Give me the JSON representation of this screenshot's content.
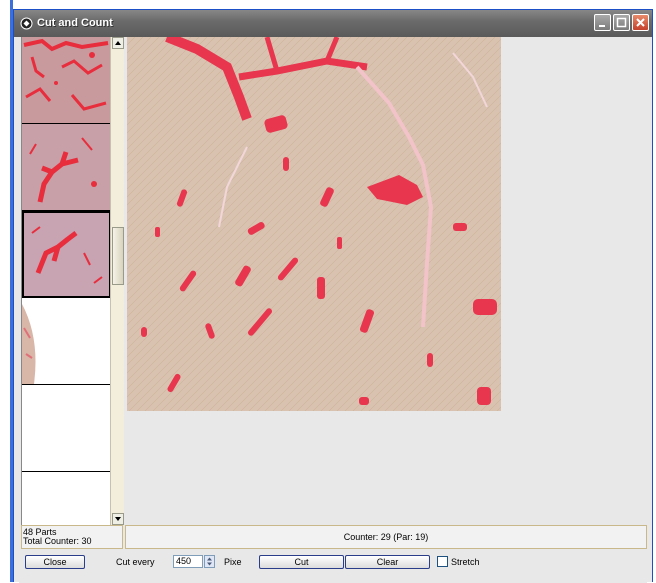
{
  "window": {
    "title": "Cut and Count"
  },
  "status": {
    "parts": "48 Parts",
    "total_counter": "Total Counter: 30",
    "counter": "Counter: 29  (Par: 19)"
  },
  "toolbar": {
    "close_label": "Close",
    "cut_every_label": "Cut every",
    "cut_every_value": "450",
    "unit_label": "Pixe",
    "cut_label": "Cut",
    "clear_label": "Clear",
    "stretch_label": "Stretch",
    "stretch_checked": false
  },
  "thumbnails": {
    "count_visible": 6,
    "selected_index": 2
  },
  "colors": {
    "tissue": "#d9c3b0",
    "stain": "#e8364f",
    "window_frame": "#1b4fc8"
  }
}
